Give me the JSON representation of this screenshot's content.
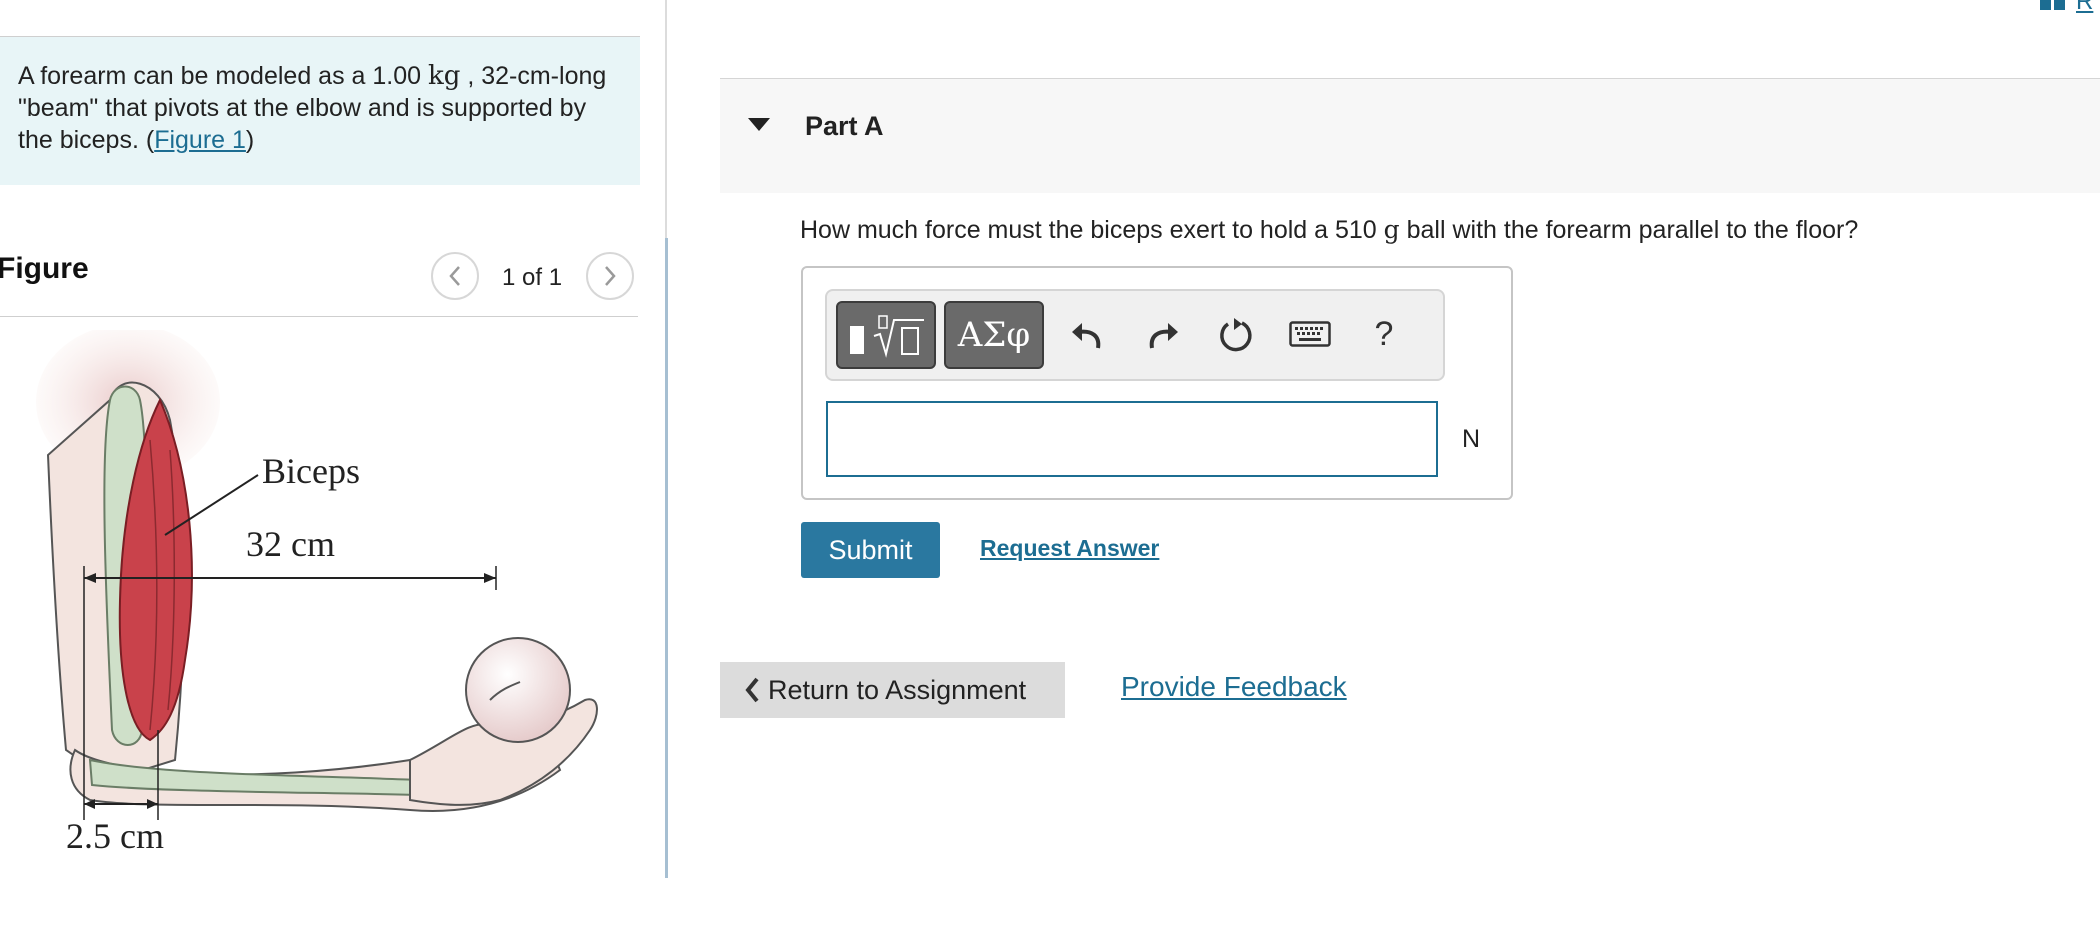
{
  "problem": {
    "text_before": "A forearm can be modeled as a 1.00 ",
    "mass_unit": "kg",
    "text_after": " , 32-cm-long \"beam\" that pivots at the elbow and is supported by the biceps. (",
    "figure_link": "Figure 1",
    "text_close": ")"
  },
  "figure": {
    "heading": "Figure",
    "counter": "1 of 1",
    "labels": {
      "muscle": "Biceps",
      "forearm_length": "32 cm",
      "elbow_offset": "2.5 cm"
    }
  },
  "header_link": "R",
  "part": {
    "title": "Part A",
    "question_before": "How much force must the biceps exert to hold a 510 ",
    "question_unit": "g",
    "question_after": " ball with the forearm parallel to the floor?"
  },
  "toolbar": {
    "symbols_label": "ΑΣφ",
    "help_label": "?"
  },
  "answer": {
    "value": "",
    "unit": "N"
  },
  "actions": {
    "submit": "Submit",
    "request_answer": "Request Answer",
    "return": "Return to Assignment",
    "feedback": "Provide Feedback"
  },
  "colors": {
    "accent": "#2a78a0",
    "link": "#1c6d92",
    "problem_bg": "#e8f5f7"
  }
}
